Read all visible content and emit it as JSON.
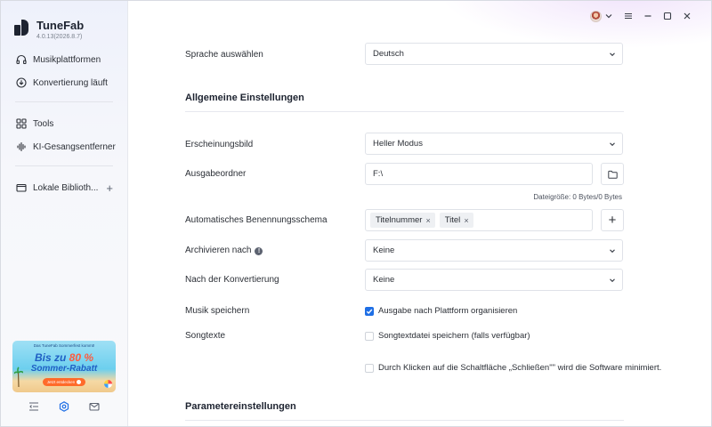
{
  "app": {
    "name": "TuneFab",
    "version": "4.0.13(2026.8.7)"
  },
  "sidebar": {
    "items": [
      {
        "label": "Musikplattformen",
        "icon": "headphones-icon"
      },
      {
        "label": "Konvertierung läuft",
        "icon": "download-circle-icon"
      },
      {
        "label": "Tools",
        "icon": "grid-icon"
      },
      {
        "label": "KI-Gesangsentferner",
        "icon": "sound-wave-icon"
      },
      {
        "label": "Lokale Biblioth...",
        "icon": "folder-icon"
      }
    ],
    "add_symbol": "+",
    "banner": {
      "top_text": "Das TuneFab Sommerfest kommt!",
      "line1_prefix": "Bis zu ",
      "line1_percent": "80 %",
      "line2": "Sommer-Rabatt",
      "cta": "Jetzt entdecken"
    }
  },
  "settings": {
    "language": {
      "label": "Sprache auswählen",
      "value": "Deutsch"
    },
    "general_title": "Allgemeine Einstellungen",
    "appearance": {
      "label": "Erscheinungsbild",
      "value": "Heller Modus"
    },
    "output_folder": {
      "label": "Ausgabeordner",
      "value": "F:\\"
    },
    "file_size": "Dateigröße: 0 Bytes/0 Bytes",
    "naming": {
      "label": "Automatisches Benennungsschema",
      "tags": [
        "Titelnummer",
        "Titel"
      ],
      "add_symbol": "+"
    },
    "archive": {
      "label": "Archivieren nach",
      "value": "Keine"
    },
    "after_conversion": {
      "label": "Nach der Konvertierung",
      "value": "Keine"
    },
    "save_music": {
      "label": "Musik speichern",
      "option": "Ausgabe nach Plattform organisieren",
      "checked": true
    },
    "lyrics": {
      "label": "Songtexte",
      "option": "Songtextdatei speichern (falls verfügbar)",
      "checked": false
    },
    "minimize": {
      "option": "Durch Klicken auf die Schaltfläche „Schließen\"\" wird die Software minimiert.",
      "checked": false
    },
    "param_title": "Parametereinstellungen"
  },
  "colors": {
    "accent": "#1f6fe5",
    "text": "#2b2f36",
    "border": "#dfe2e8"
  }
}
